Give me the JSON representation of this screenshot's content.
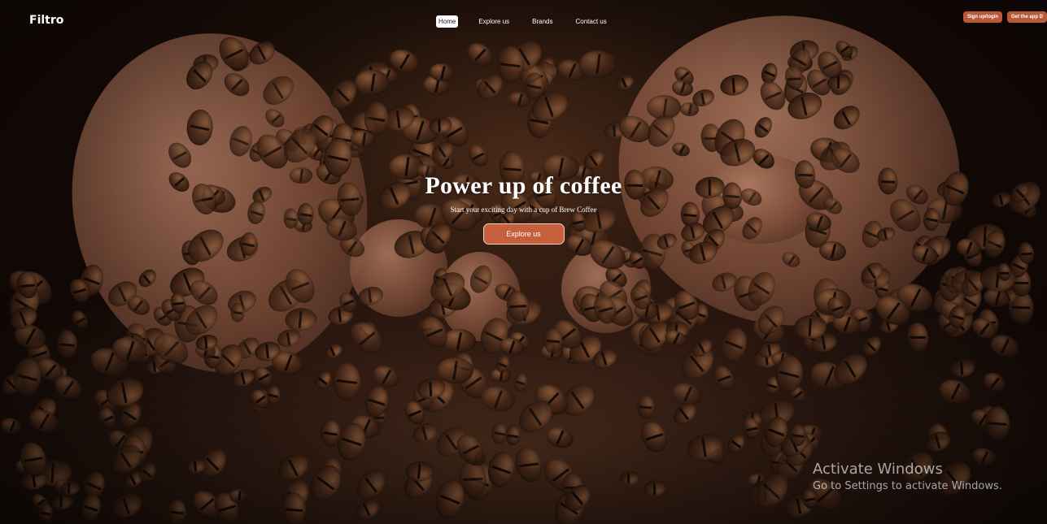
{
  "brand": "Filtro",
  "nav": {
    "items": [
      {
        "label": "Home",
        "active": true
      },
      {
        "label": "Explore us",
        "active": false
      },
      {
        "label": "Brands",
        "active": false
      },
      {
        "label": "Contact us",
        "active": false
      }
    ]
  },
  "auth": {
    "login_label": "Sign up/login",
    "app_label": "Get the app D"
  },
  "hero": {
    "title": "Power up of coffee",
    "subtitle": "Start your exciting day with a cup of Brew Coffee",
    "cta_label": "Explore us",
    "background_image": "coffee-beans-in-hands"
  },
  "watermark": {
    "title": "Activate Windows",
    "subtitle": "Go to Settings to activate Windows."
  },
  "colors": {
    "accent": "#c65f3c",
    "text": "#ffffff",
    "background": "#1c110b"
  }
}
